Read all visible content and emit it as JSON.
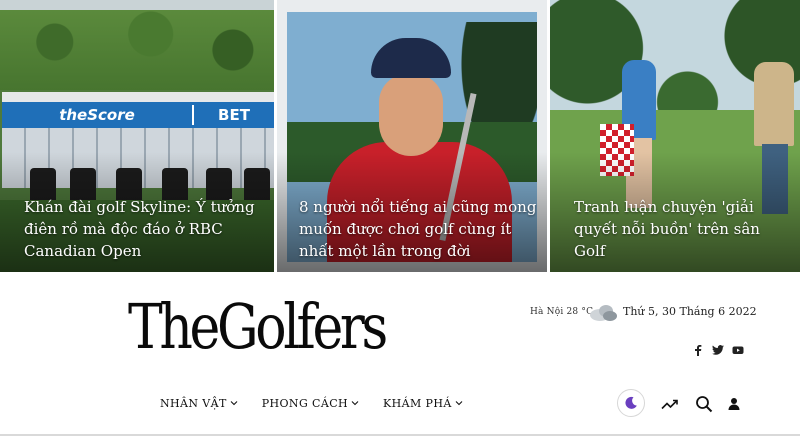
{
  "featured": [
    {
      "title": "Khán đài golf Skyline: Ý tưởng điên rồ mà độc đáo ở RBC Canadian Open",
      "image_label": "theScore | BET"
    },
    {
      "title": "8 người nổi tiếng ai cũng mong muốn được chơi golf cùng ít nhất một lần trong đời"
    },
    {
      "title": "Tranh luận chuyện 'giải quyết nỗi buồn' trên sân Golf"
    }
  ],
  "banner": {
    "left": "theScore",
    "right": "BET"
  },
  "logo": {
    "text": "TheGolfers"
  },
  "weather": {
    "location_temp": "Hà Nội 28 °C",
    "icon": "cloudy-icon"
  },
  "date": "Thứ 5, 30 Tháng 6 2022",
  "social": [
    {
      "name": "facebook-icon"
    },
    {
      "name": "twitter-icon"
    },
    {
      "name": "youtube-icon"
    }
  ],
  "nav": [
    {
      "label": "NHÂN VẬT"
    },
    {
      "label": "PHONG CÁCH"
    },
    {
      "label": "KHÁM PHÁ"
    }
  ],
  "tools": {
    "dark_mode_icon": "moon-icon",
    "trending_icon": "trending-icon",
    "search_icon": "search-icon",
    "user_icon": "user-icon"
  },
  "colors": {
    "accent": "#6a3fbf",
    "text": "#111111",
    "banner_blue": "#1f6fb8"
  }
}
